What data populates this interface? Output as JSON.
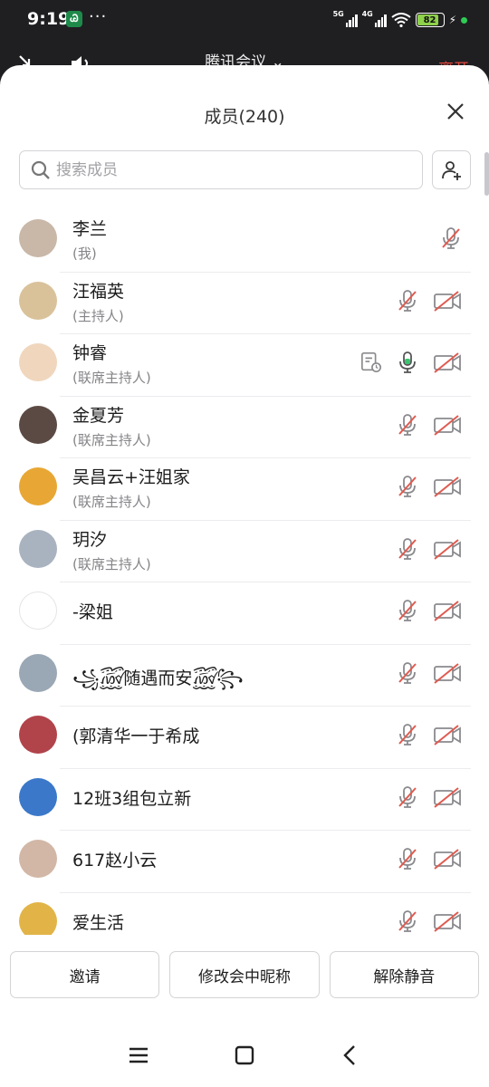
{
  "status_bar": {
    "time": "9:19",
    "app_badge": "Ꮚ",
    "more": "···",
    "net1": "5G",
    "net2": "4G",
    "battery": "82",
    "battery_color": "#8ed14a"
  },
  "meeting_header": {
    "title": "腾讯会议",
    "leave_label": "离开",
    "leave_color": "#e5483d"
  },
  "sheet": {
    "title": "成员(240)",
    "search_placeholder": "搜索成员"
  },
  "members": [
    {
      "name": "李兰",
      "role": "(我)",
      "mic": "muted",
      "camera": "none",
      "avatar_color": "#c9b7a8"
    },
    {
      "name": "汪福英",
      "role": "(主持人)",
      "mic": "muted",
      "camera": "off",
      "avatar_color": "#d9c29a"
    },
    {
      "name": "钟睿",
      "role": "(联席主持人)",
      "mic": "on",
      "camera": "off",
      "doc_icon": true,
      "avatar_color": "#f0d6bd"
    },
    {
      "name": "金夏芳",
      "role": "(联席主持人)",
      "mic": "muted",
      "camera": "off",
      "avatar_color": "#5b4a43"
    },
    {
      "name": "吴昌云+汪姐家",
      "role": "(联席主持人)",
      "mic": "muted",
      "camera": "off",
      "avatar_color": "#e8a734"
    },
    {
      "name": "玥汐",
      "role": "(联席主持人)",
      "mic": "muted",
      "camera": "off",
      "avatar_color": "#a9b3bf"
    },
    {
      "name": "-梁姐",
      "role": "",
      "mic": "muted",
      "camera": "off",
      "avatar_color": "#ffffff"
    },
    {
      "name": "꧁꫞随遇而安꫞꧂",
      "role": "",
      "mic": "muted",
      "camera": "off",
      "avatar_color": "#9aa7b5"
    },
    {
      "name": "(郭清华一于希成",
      "role": "",
      "mic": "muted",
      "camera": "off",
      "avatar_color": "#b1434a"
    },
    {
      "name": "12班3组包立新",
      "role": "",
      "mic": "muted",
      "camera": "off",
      "avatar_color": "#3b78c9"
    },
    {
      "name": "617赵小云",
      "role": "",
      "mic": "muted",
      "camera": "off",
      "avatar_color": "#d2b7a6"
    },
    {
      "name": "爱生活",
      "role": "",
      "mic": "muted",
      "camera": "off",
      "avatar_color": "#e2b447"
    }
  ],
  "actions": {
    "invite": "邀请",
    "rename": "修改会中昵称",
    "unmute_all": "解除静音"
  },
  "colors": {
    "muted_red": "#e05a4f",
    "active_green": "#3cc470",
    "icon_gray": "#8a8a8e"
  }
}
